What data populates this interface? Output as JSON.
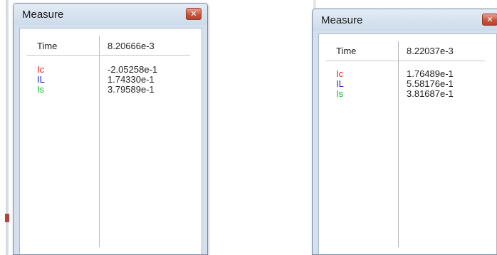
{
  "windows": [
    {
      "title": "Measure",
      "close_glyph": "✕",
      "time_label": "Time",
      "time_value": "8.20666e-3",
      "signals": [
        {
          "label": "Ic",
          "value": "-2.05258e-1",
          "color": "#e0211b"
        },
        {
          "label": "IL",
          "value": "1.74330e-1",
          "color": "#1f2ad1"
        },
        {
          "label": "Is",
          "value": "3.79589e-1",
          "color": "#16c228"
        }
      ]
    },
    {
      "title": "Measure",
      "close_glyph": "✕",
      "time_label": "Time",
      "time_value": "8.22037e-3",
      "signals": [
        {
          "label": "Ic",
          "value": "1.76489e-1",
          "color": "#e0211b"
        },
        {
          "label": "IL",
          "value": "5.58176e-1",
          "color": "#1f2ad1"
        },
        {
          "label": "Is",
          "value": "3.81687e-1",
          "color": "#16c228"
        }
      ]
    }
  ]
}
